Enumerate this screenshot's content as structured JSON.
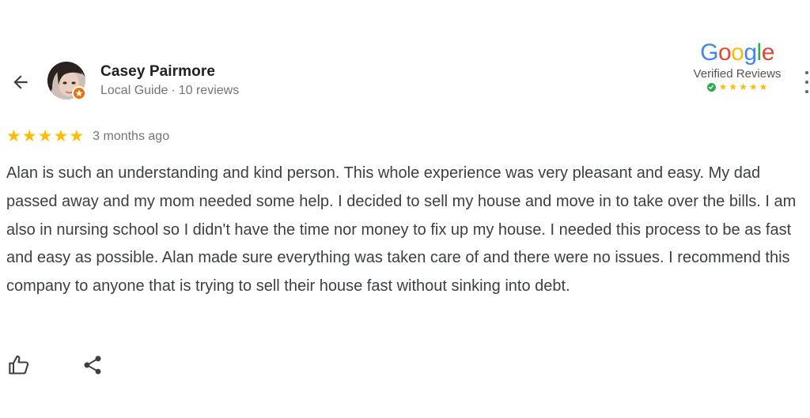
{
  "reviewer": {
    "name": "Casey Pairmore",
    "level": "Local Guide",
    "separator": "·",
    "review_count": "10 reviews"
  },
  "badge": {
    "logo_letters": [
      {
        "char": "G",
        "color": "#4285F4"
      },
      {
        "char": "o",
        "color": "#EA4335"
      },
      {
        "char": "o",
        "color": "#FBBC05"
      },
      {
        "char": "g",
        "color": "#4285F4"
      },
      {
        "char": "l",
        "color": "#34A853"
      },
      {
        "char": "e",
        "color": "#EA4335"
      }
    ],
    "label": "Verified Reviews",
    "star_count": 5
  },
  "review": {
    "rating": 5,
    "date": "3 months ago",
    "text": "Alan is such an understanding and kind person. This whole experience was very pleasant and easy. My dad passed away and my mom needed some help. I decided to sell my house and move in to take over the bills. I am also in nursing school so I didn't have the time nor money to fix up my house. I needed this process to be as fast and easy as possible. Alan made sure everything was taken care of and there were no issues. I recommend this company to anyone that is trying to sell their house fast without sinking into debt."
  },
  "icons": {
    "back": "arrow-left-icon",
    "like": "thumb-up-icon",
    "share": "share-icon",
    "more": "more-vert-icon",
    "guide_badge": "local-guide-badge-icon"
  },
  "colors": {
    "star": "#fbbc04",
    "guide_badge": "#e8710a",
    "verified_check": "#34a853",
    "name_text": "#202124",
    "secondary_text": "#70757a"
  }
}
